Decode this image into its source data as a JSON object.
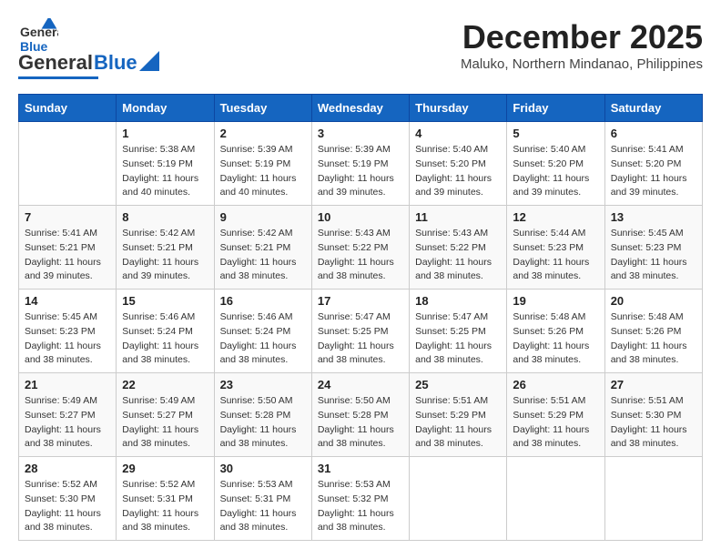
{
  "header": {
    "logo_general": "General",
    "logo_blue": "Blue",
    "month_year": "December 2025",
    "location": "Maluko, Northern Mindanao, Philippines"
  },
  "weekdays": [
    "Sunday",
    "Monday",
    "Tuesday",
    "Wednesday",
    "Thursday",
    "Friday",
    "Saturday"
  ],
  "weeks": [
    [
      {
        "day": "",
        "info": ""
      },
      {
        "day": "1",
        "info": "Sunrise: 5:38 AM\nSunset: 5:19 PM\nDaylight: 11 hours\nand 40 minutes."
      },
      {
        "day": "2",
        "info": "Sunrise: 5:39 AM\nSunset: 5:19 PM\nDaylight: 11 hours\nand 40 minutes."
      },
      {
        "day": "3",
        "info": "Sunrise: 5:39 AM\nSunset: 5:19 PM\nDaylight: 11 hours\nand 39 minutes."
      },
      {
        "day": "4",
        "info": "Sunrise: 5:40 AM\nSunset: 5:20 PM\nDaylight: 11 hours\nand 39 minutes."
      },
      {
        "day": "5",
        "info": "Sunrise: 5:40 AM\nSunset: 5:20 PM\nDaylight: 11 hours\nand 39 minutes."
      },
      {
        "day": "6",
        "info": "Sunrise: 5:41 AM\nSunset: 5:20 PM\nDaylight: 11 hours\nand 39 minutes."
      }
    ],
    [
      {
        "day": "7",
        "info": "Sunrise: 5:41 AM\nSunset: 5:21 PM\nDaylight: 11 hours\nand 39 minutes."
      },
      {
        "day": "8",
        "info": "Sunrise: 5:42 AM\nSunset: 5:21 PM\nDaylight: 11 hours\nand 39 minutes."
      },
      {
        "day": "9",
        "info": "Sunrise: 5:42 AM\nSunset: 5:21 PM\nDaylight: 11 hours\nand 38 minutes."
      },
      {
        "day": "10",
        "info": "Sunrise: 5:43 AM\nSunset: 5:22 PM\nDaylight: 11 hours\nand 38 minutes."
      },
      {
        "day": "11",
        "info": "Sunrise: 5:43 AM\nSunset: 5:22 PM\nDaylight: 11 hours\nand 38 minutes."
      },
      {
        "day": "12",
        "info": "Sunrise: 5:44 AM\nSunset: 5:23 PM\nDaylight: 11 hours\nand 38 minutes."
      },
      {
        "day": "13",
        "info": "Sunrise: 5:45 AM\nSunset: 5:23 PM\nDaylight: 11 hours\nand 38 minutes."
      }
    ],
    [
      {
        "day": "14",
        "info": "Sunrise: 5:45 AM\nSunset: 5:23 PM\nDaylight: 11 hours\nand 38 minutes."
      },
      {
        "day": "15",
        "info": "Sunrise: 5:46 AM\nSunset: 5:24 PM\nDaylight: 11 hours\nand 38 minutes."
      },
      {
        "day": "16",
        "info": "Sunrise: 5:46 AM\nSunset: 5:24 PM\nDaylight: 11 hours\nand 38 minutes."
      },
      {
        "day": "17",
        "info": "Sunrise: 5:47 AM\nSunset: 5:25 PM\nDaylight: 11 hours\nand 38 minutes."
      },
      {
        "day": "18",
        "info": "Sunrise: 5:47 AM\nSunset: 5:25 PM\nDaylight: 11 hours\nand 38 minutes."
      },
      {
        "day": "19",
        "info": "Sunrise: 5:48 AM\nSunset: 5:26 PM\nDaylight: 11 hours\nand 38 minutes."
      },
      {
        "day": "20",
        "info": "Sunrise: 5:48 AM\nSunset: 5:26 PM\nDaylight: 11 hours\nand 38 minutes."
      }
    ],
    [
      {
        "day": "21",
        "info": "Sunrise: 5:49 AM\nSunset: 5:27 PM\nDaylight: 11 hours\nand 38 minutes."
      },
      {
        "day": "22",
        "info": "Sunrise: 5:49 AM\nSunset: 5:27 PM\nDaylight: 11 hours\nand 38 minutes."
      },
      {
        "day": "23",
        "info": "Sunrise: 5:50 AM\nSunset: 5:28 PM\nDaylight: 11 hours\nand 38 minutes."
      },
      {
        "day": "24",
        "info": "Sunrise: 5:50 AM\nSunset: 5:28 PM\nDaylight: 11 hours\nand 38 minutes."
      },
      {
        "day": "25",
        "info": "Sunrise: 5:51 AM\nSunset: 5:29 PM\nDaylight: 11 hours\nand 38 minutes."
      },
      {
        "day": "26",
        "info": "Sunrise: 5:51 AM\nSunset: 5:29 PM\nDaylight: 11 hours\nand 38 minutes."
      },
      {
        "day": "27",
        "info": "Sunrise: 5:51 AM\nSunset: 5:30 PM\nDaylight: 11 hours\nand 38 minutes."
      }
    ],
    [
      {
        "day": "28",
        "info": "Sunrise: 5:52 AM\nSunset: 5:30 PM\nDaylight: 11 hours\nand 38 minutes."
      },
      {
        "day": "29",
        "info": "Sunrise: 5:52 AM\nSunset: 5:31 PM\nDaylight: 11 hours\nand 38 minutes."
      },
      {
        "day": "30",
        "info": "Sunrise: 5:53 AM\nSunset: 5:31 PM\nDaylight: 11 hours\nand 38 minutes."
      },
      {
        "day": "31",
        "info": "Sunrise: 5:53 AM\nSunset: 5:32 PM\nDaylight: 11 hours\nand 38 minutes."
      },
      {
        "day": "",
        "info": ""
      },
      {
        "day": "",
        "info": ""
      },
      {
        "day": "",
        "info": ""
      }
    ]
  ]
}
